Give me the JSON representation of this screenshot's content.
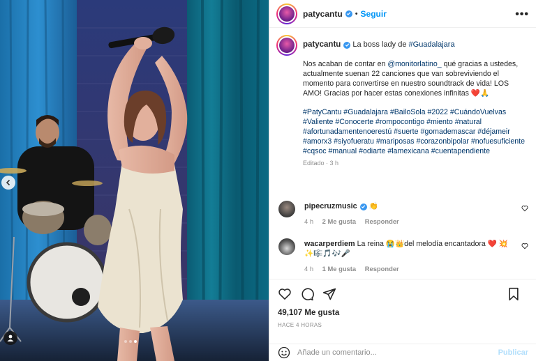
{
  "header": {
    "username": "patycantu",
    "separator": "•",
    "follow_label": "Seguir",
    "more_label": "•••"
  },
  "caption": {
    "username": "patycantu",
    "title_prefix": "La boss lady de ",
    "title_hashtag": "#Guadalajara",
    "text_before": "Nos acaban de contar en ",
    "mention": "@monitorlatino_",
    "text_after": " qué gracias a ustedes, actualmente suenan 22 canciones que van sobreviviendo el momento para convertirse en nuestro soundtrack de vida! LOS AMO! Gracias por hacer estas conexiones infinitas ❤️🙏",
    "hashtags": "#PatyCantu #Guadalajara #BailoSola #2022 #CuándoVuelvas #Valiente #Conocerte #rompocontigo #miento #natural #afortunadamentenoerestú #suerte #gomademascar #déjameir #amorx3 #siyofueratu #mariposas #corazonbipolar #nofuesuficiente #cqsoc #manual #odiarte #lamexicana #cuentapendiente",
    "edited": "Editado · 3 h"
  },
  "comments": [
    {
      "username": "pipecruzmusic",
      "text": "👏",
      "time": "4 h",
      "likes": "2 Me gusta",
      "reply": "Responder"
    },
    {
      "username": "wacarperdiem",
      "text": "La reina 😭👑del melodía encantadora ❤️ 💥✨🎼🎵🎶🎤",
      "time": "4 h",
      "likes": "1 Me gusta",
      "reply": "Responder"
    }
  ],
  "actions": {
    "likes": "49,107 Me gusta",
    "time": "HACE 4 HORAS"
  },
  "add_comment": {
    "placeholder": "Añade un comentario...",
    "publish_label": "Publicar"
  },
  "carousel": {
    "slides": 3,
    "active_slide": 3
  },
  "colors": {
    "accent": "#0095f6",
    "verified": "#3897f0",
    "link": "#00376b",
    "muted": "#8e8e8e",
    "curtain": "#0d6f86"
  }
}
